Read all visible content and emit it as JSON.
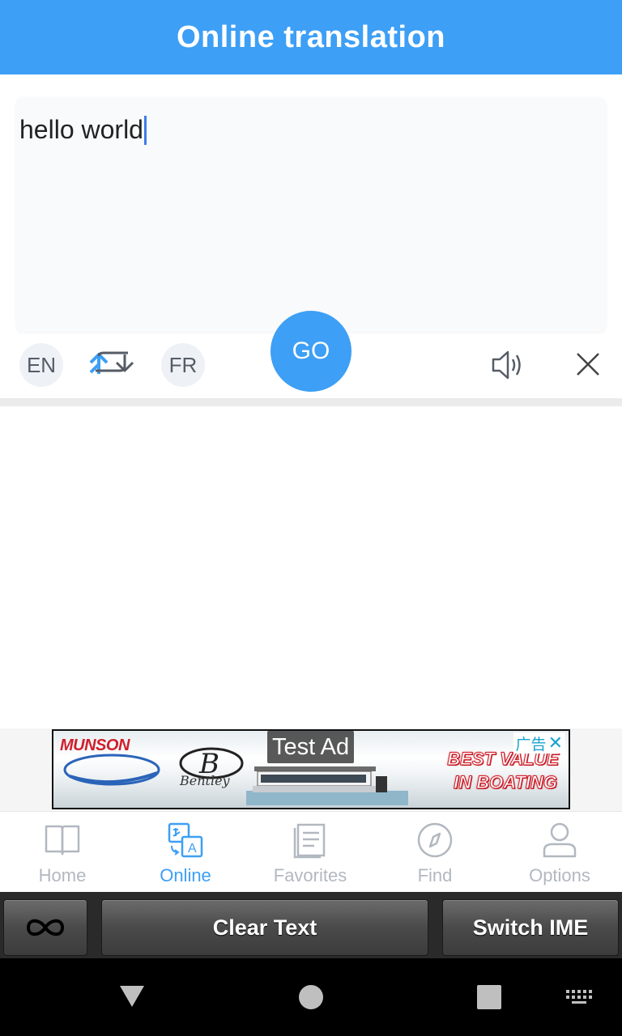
{
  "header": {
    "title": "Online translation"
  },
  "input": {
    "value": "hello world"
  },
  "controls": {
    "source_lang": "EN",
    "target_lang": "FR",
    "go_label": "GO"
  },
  "ad": {
    "label": "Test Ad",
    "brand1": "MUNSON",
    "brand2": "Bentley",
    "headline_line1": "BEST VALUE",
    "headline_line2": "IN BOATING",
    "choice_text": "广告",
    "choice_close": "✕"
  },
  "bottom_nav": {
    "items": [
      {
        "label": "Home",
        "icon": "book-icon",
        "active": false
      },
      {
        "label": "Online",
        "icon": "translate-icon",
        "active": true
      },
      {
        "label": "Favorites",
        "icon": "document-icon",
        "active": false
      },
      {
        "label": "Find",
        "icon": "compass-icon",
        "active": false
      },
      {
        "label": "Options",
        "icon": "person-icon",
        "active": false
      }
    ]
  },
  "ime_bar": {
    "clear_label": "Clear Text",
    "switch_label": "Switch IME"
  },
  "colors": {
    "accent": "#3d9ff5",
    "inactive": "#b2b8c0",
    "ad_red": "#d01f2a"
  }
}
